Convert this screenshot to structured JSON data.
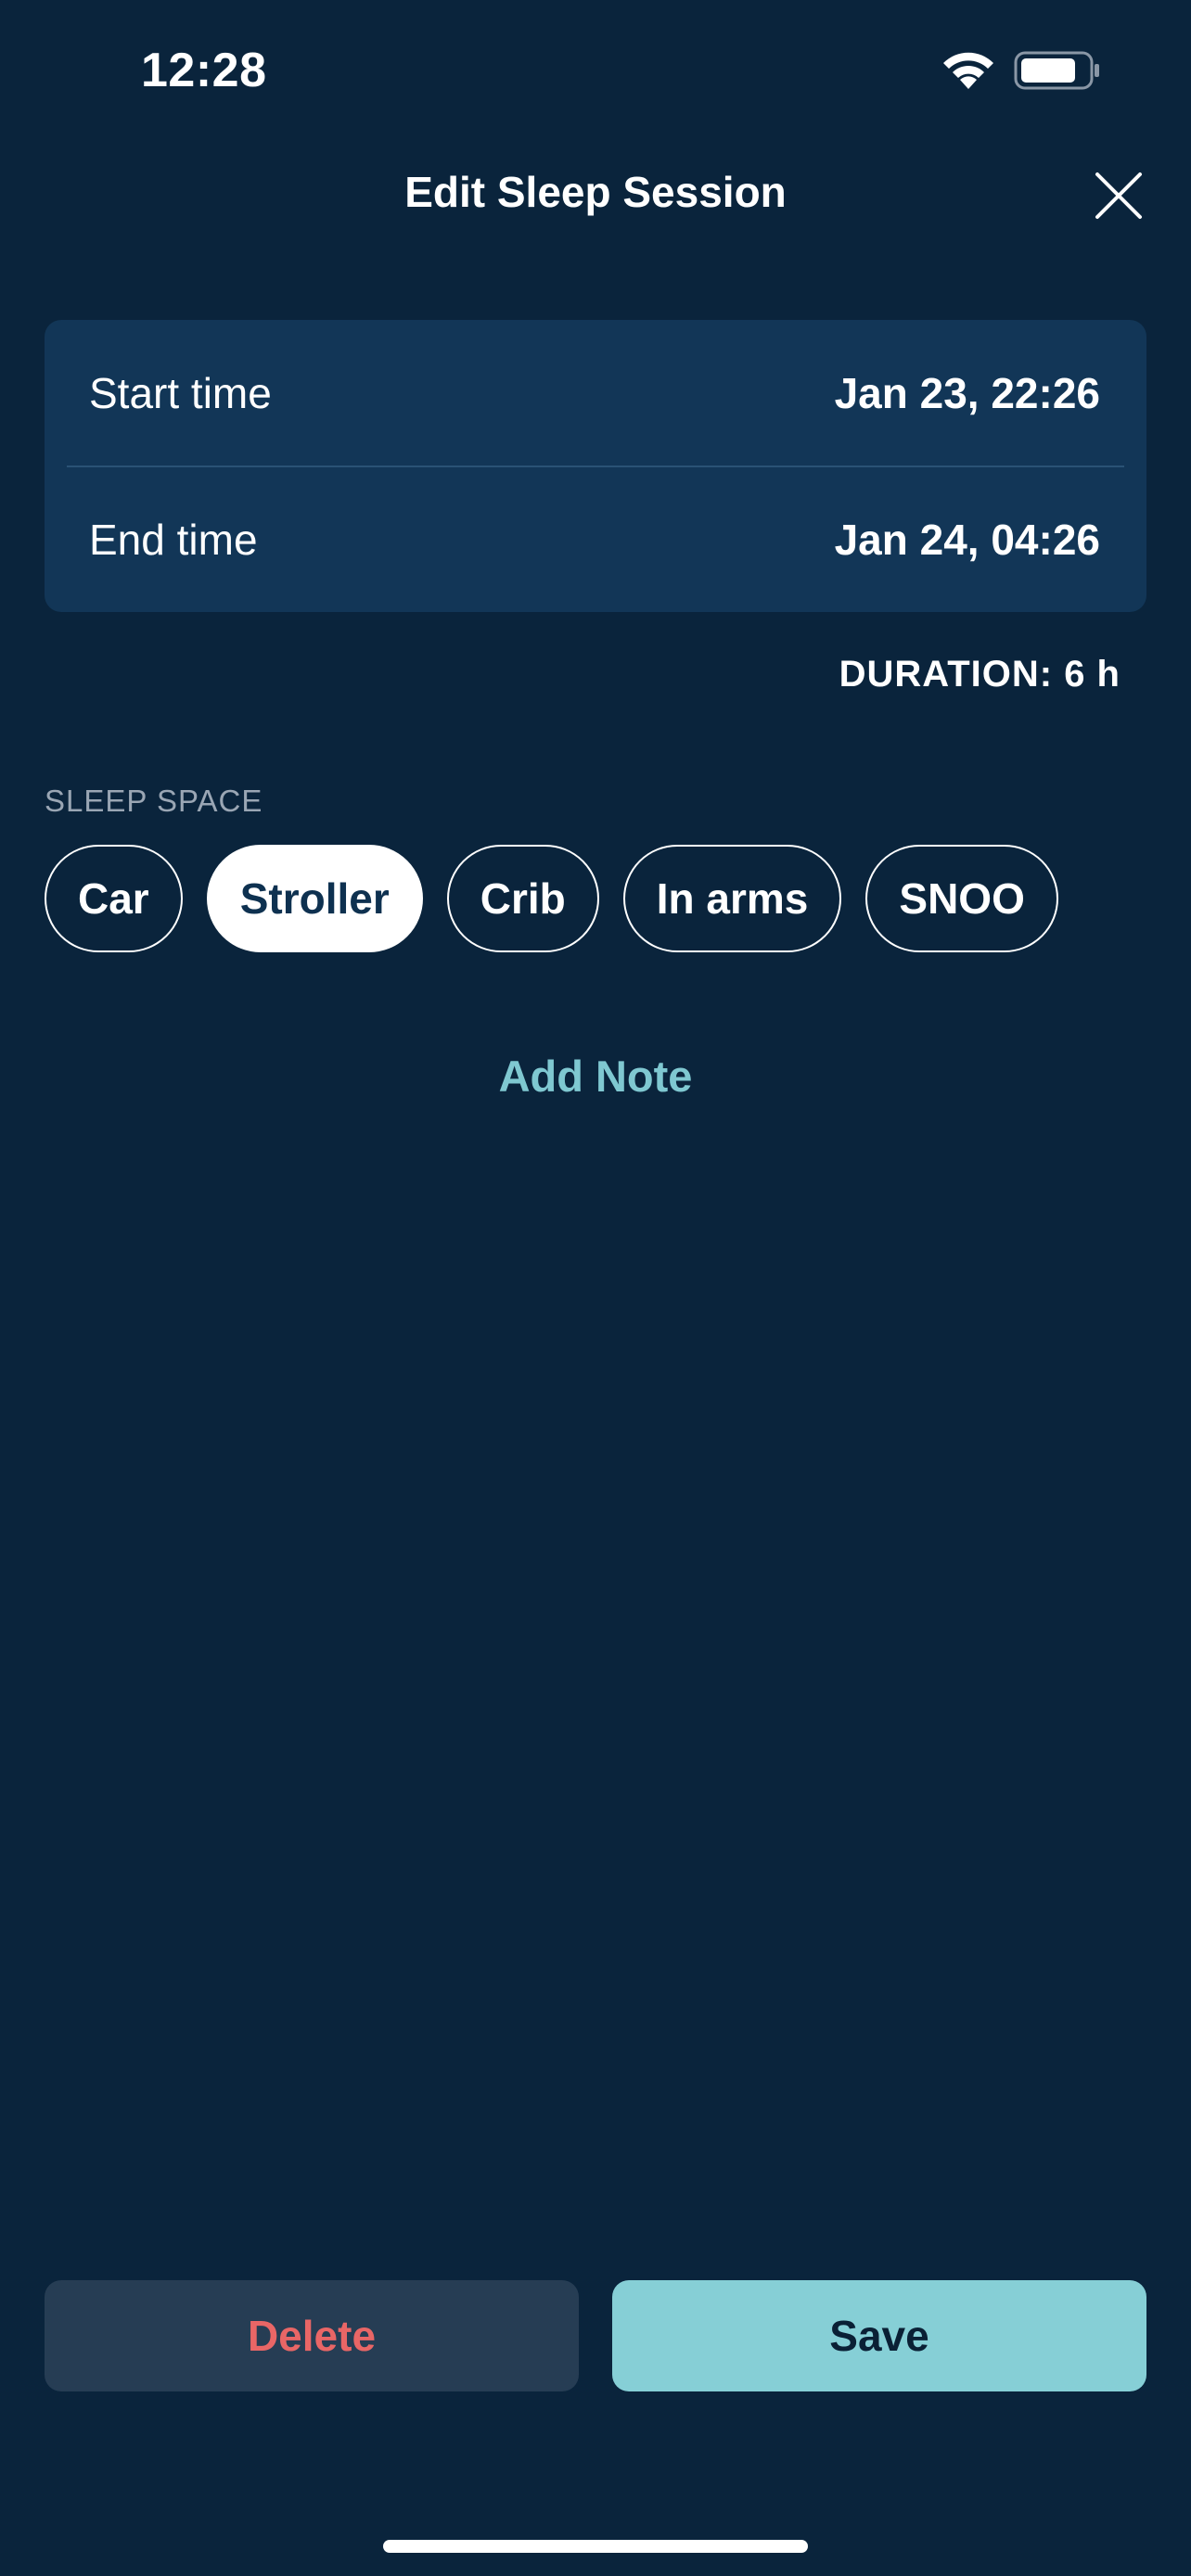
{
  "status_bar": {
    "time": "12:28"
  },
  "header": {
    "title": "Edit Sleep Session",
    "close_icon": "close-icon"
  },
  "times": {
    "start_label": "Start time",
    "start_value": "Jan 23, 22:26",
    "end_label": "End time",
    "end_value": "Jan 24, 04:26"
  },
  "duration": "DURATION: 6 h",
  "sleep_space": {
    "label": "SLEEP SPACE",
    "options": [
      "Car",
      "Stroller",
      "Crib",
      "In arms",
      "SNOO"
    ],
    "selected": "Stroller"
  },
  "add_note_label": "Add Note",
  "actions": {
    "delete_label": "Delete",
    "save_label": "Save"
  },
  "colors": {
    "background": "#0a243c",
    "card": "#123657",
    "accent": "#86cfd6",
    "link": "#7fc8d1",
    "danger": "#e96666"
  }
}
